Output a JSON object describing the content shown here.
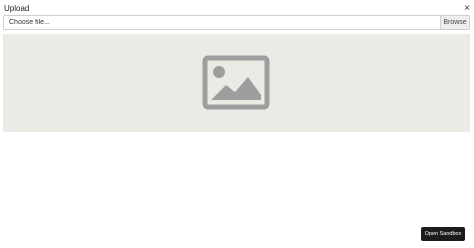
{
  "dialog": {
    "title": "Upload",
    "close_icon": "close-icon",
    "close_glyph": "×"
  },
  "file_picker": {
    "placeholder": "Choose file...",
    "value": "",
    "browse_label": "Browse"
  },
  "preview": {
    "icon": "image-placeholder-icon",
    "background": "#ebebe6",
    "icon_color": "#9e9e9e"
  },
  "footer": {
    "open_sandbox_label": "Open Sandbox",
    "button_color": "#1c1c1c"
  }
}
